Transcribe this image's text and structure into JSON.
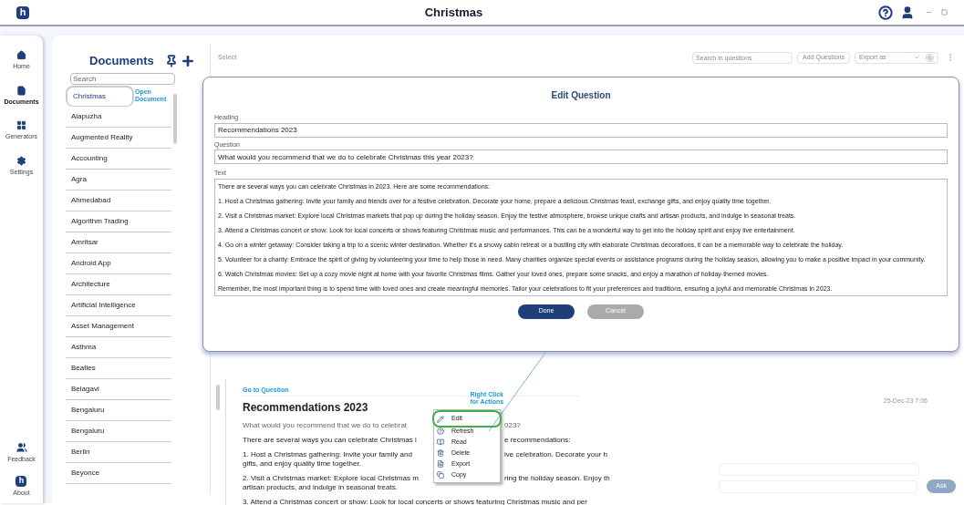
{
  "window": {
    "title": "Christmas",
    "logo": "h"
  },
  "nav": {
    "items": [
      {
        "label": "Home",
        "kind": "home",
        "selected": false
      },
      {
        "label": "Documents",
        "kind": "file",
        "selected": true
      },
      {
        "label": "Generators",
        "kind": "grid",
        "selected": false
      },
      {
        "label": "Settings",
        "kind": "gear",
        "selected": false
      }
    ],
    "bottom": [
      {
        "label": "Feedback",
        "kind": "feedback"
      },
      {
        "label": "About",
        "kind": "about",
        "logo": "h"
      }
    ]
  },
  "documents": {
    "title": "Documents",
    "search": {
      "placeholder": "Search"
    },
    "annotation": "Open Document",
    "items": [
      {
        "label": "Christmas",
        "selected": true
      },
      {
        "label": "Alapuzha",
        "selected": false
      },
      {
        "label": "Augmented Reality",
        "selected": false
      },
      {
        "label": "Accounting",
        "selected": false
      },
      {
        "label": "Agra",
        "selected": false
      },
      {
        "label": "Ahmedabad",
        "selected": false
      },
      {
        "label": "Algorithm Trading",
        "selected": false
      },
      {
        "label": "Amritsar",
        "selected": false
      },
      {
        "label": "Android App",
        "selected": false
      },
      {
        "label": "Architecture",
        "selected": false
      },
      {
        "label": "Artificial Intelligence",
        "selected": false
      },
      {
        "label": "Asset Management",
        "selected": false
      },
      {
        "label": "Asthma",
        "selected": false
      },
      {
        "label": "Beatles",
        "selected": false
      },
      {
        "label": "Belagavi",
        "selected": false
      },
      {
        "label": "Bengaluru",
        "selected": false
      },
      {
        "label": "Bengaluru",
        "selected": false
      },
      {
        "label": "Berlin",
        "selected": false
      },
      {
        "label": "Beyonce",
        "selected": false
      }
    ]
  },
  "toolbar": {
    "select": "Select",
    "search": {
      "placeholder": "Search in questions"
    },
    "add_button": "Add Questions",
    "export": {
      "placeholder": "Export as"
    }
  },
  "modal": {
    "title": "Edit Question",
    "heading": {
      "label": "Heading",
      "value": "Recommendations 2023"
    },
    "question": {
      "label": "Question",
      "value": "What would you recommend that we do to celebrate Christmas this year 2023?"
    },
    "text": {
      "label": "Text",
      "paragraphs": [
        "There are several ways you can celebrate Christmas in 2023. Here are some recommendations:",
        "1. Host a Christmas gathering: Invite your family and friends over for a festive celebration. Decorate your home, prepare a delicious Christmas feast, exchange gifts, and enjoy quality time together.",
        "2. Visit a Christmas market: Explore local Christmas markets that pop up during the holiday season. Enjoy the festive atmosphere, browse unique crafts and artisan products, and indulge in seasonal treats.",
        "3. Attend a Christmas concert or show: Look for local concerts or shows featuring Christmas music and performances. This can be a wonderful way to get into the holiday spirit and enjoy live entertainment.",
        "4. Go on a winter getaway: Consider taking a trip to a scenic winter destination. Whether it's a snowy cabin retreat or a bustling city with elaborate Christmas decorations, it can be a memorable way to celebrate the holiday.",
        "5. Volunteer for a charity: Embrace the spirit of giving by volunteering your time to help those in need. Many charities organize special events or assistance programs during the holiday season, allowing you to make a positive impact in your community.",
        "6. Watch Christmas movies: Set up a cozy movie night at home with your favorite Christmas films. Gather your loved ones, prepare some snacks, and enjoy a marathon of holiday-themed movies.",
        "Remember, the most important thing is to spend time with loved ones and create meaningful memories. Tailor your celebrations to fit your preferences and traditions, ensuring a joyful and memorable Christmas in 2023."
      ]
    },
    "buttons": [
      {
        "label": "Done",
        "kind": "primary"
      },
      {
        "label": "Cancel",
        "kind": "secondary"
      }
    ]
  },
  "question_card": {
    "link": "Go to Question",
    "heading": "Recommendations 2023",
    "annotation": "Right Click for Actions",
    "date": "25-Dec-23 7:06",
    "ask_button": "Ask",
    "lines": [
      {
        "kind": "question",
        "parts": [
          "What would you recommend that we do to celebrat",
          "023?"
        ]
      },
      {
        "kind": "para",
        "parts": [
          "There are several ways you can celebrate Christmas i",
          "e recommendations:"
        ]
      },
      {
        "kind": "para",
        "parts": [
          "1. Host a Christmas gathering: Invite your family and",
          "ive celebration. Decorate your h"
        ],
        "more": "gifts, and enjoy quality time together."
      },
      {
        "kind": "para",
        "parts": [
          "2. Visit a Christmas market: Explore local Christmas m",
          "ring the holiday season. Enjoy th"
        ],
        "more": "artisan products, and indulge in seasonal treats."
      },
      {
        "kind": "para",
        "parts": [
          "3. Attend a Christmas concert or show: Look for local concerts or shows featuring Christmas music and per"
        ]
      }
    ]
  },
  "context_menu": {
    "items": [
      {
        "label": "Edit",
        "kind": "edit",
        "highlighted": true
      },
      {
        "label": "Refresh",
        "kind": "refresh",
        "highlighted": false
      },
      {
        "label": "Read",
        "kind": "read",
        "highlighted": false
      },
      {
        "label": "Delete",
        "kind": "delete",
        "highlighted": false
      },
      {
        "label": "Export",
        "kind": "export",
        "highlighted": false
      },
      {
        "label": "Copy",
        "kind": "copy",
        "highlighted": false
      }
    ]
  }
}
